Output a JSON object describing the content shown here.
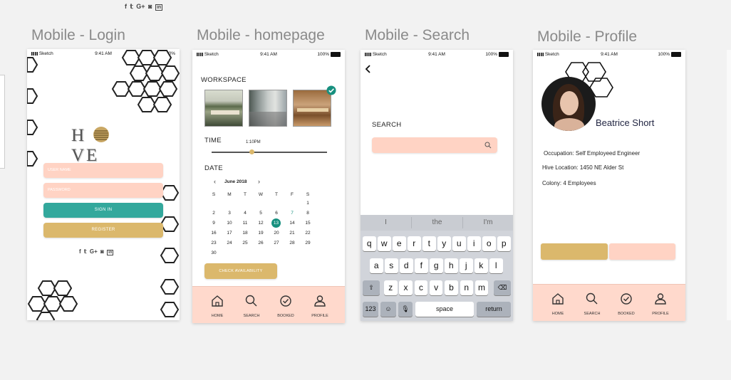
{
  "top_social": [
    "f",
    "𝕥",
    "G+",
    "◙",
    "in"
  ],
  "artboards": {
    "login": "Mobile - Login",
    "home": "Mobile - homepage",
    "search": "Mobile - Search",
    "profile": "Mobile - Profile"
  },
  "status_bar": {
    "carrier": "Sketch",
    "time": "9:41 AM",
    "battery": "100%"
  },
  "colors": {
    "peach": "#ffd3c4",
    "teal": "#33a89c",
    "gold": "#dbb86c",
    "tabbar": "#ffd9cc",
    "calendar_selected": "#17907f"
  },
  "login": {
    "logo_left": "H",
    "logo_right": "VE",
    "username_placeholder": "USER NAME",
    "password_placeholder": "PASSWORD",
    "signin_label": "SIGN IN",
    "register_label": "REGISTER",
    "social": [
      "f",
      "𝕥",
      "G+",
      "◙",
      "in"
    ]
  },
  "home": {
    "workspace_title": "WORKSPACE",
    "time_title": "TIME",
    "time_value": "1:10PM",
    "time_slider_fraction": 0.35,
    "date_title": "DATE",
    "month": "June 2018",
    "weekdays": [
      "S",
      "M",
      "T",
      "W",
      "T",
      "F",
      "S"
    ],
    "days": [
      [
        "",
        "",
        "",
        "",
        "",
        "",
        "1"
      ],
      [
        "2",
        "3",
        "4",
        "5",
        "6",
        "7",
        "8"
      ],
      [
        "9",
        "10",
        "11",
        "12",
        "13",
        "14",
        "15"
      ],
      [
        "16",
        "17",
        "18",
        "19",
        "20",
        "21",
        "22"
      ],
      [
        "23",
        "24",
        "25",
        "26",
        "27",
        "28",
        "29"
      ],
      [
        "30",
        "",
        "",
        "",
        "",
        "",
        ""
      ]
    ],
    "selected_day": "13",
    "check_label": "CHECK AVAILABILITY"
  },
  "tabs": [
    "HOME",
    "SEARCH",
    "BOOKED",
    "PROFILE"
  ],
  "search": {
    "back_icon": "chevron-left",
    "title": "SEARCH",
    "suggestions": [
      "I",
      "the",
      "I'm"
    ],
    "row1": [
      "q",
      "w",
      "e",
      "r",
      "t",
      "y",
      "u",
      "i",
      "o",
      "p"
    ],
    "row2": [
      "a",
      "s",
      "d",
      "f",
      "g",
      "h",
      "j",
      "k",
      "l"
    ],
    "row3": [
      "z",
      "x",
      "c",
      "v",
      "b",
      "n",
      "m"
    ],
    "numbers_key": "123",
    "space_key": "space",
    "return_key": "return"
  },
  "profile": {
    "name": "Beatrice Short",
    "occupation": "Occupation: Self Employeed Engineer",
    "location": "Hive Location: 1450 NE Alder St",
    "colony": "Colony: 4 Employees"
  }
}
